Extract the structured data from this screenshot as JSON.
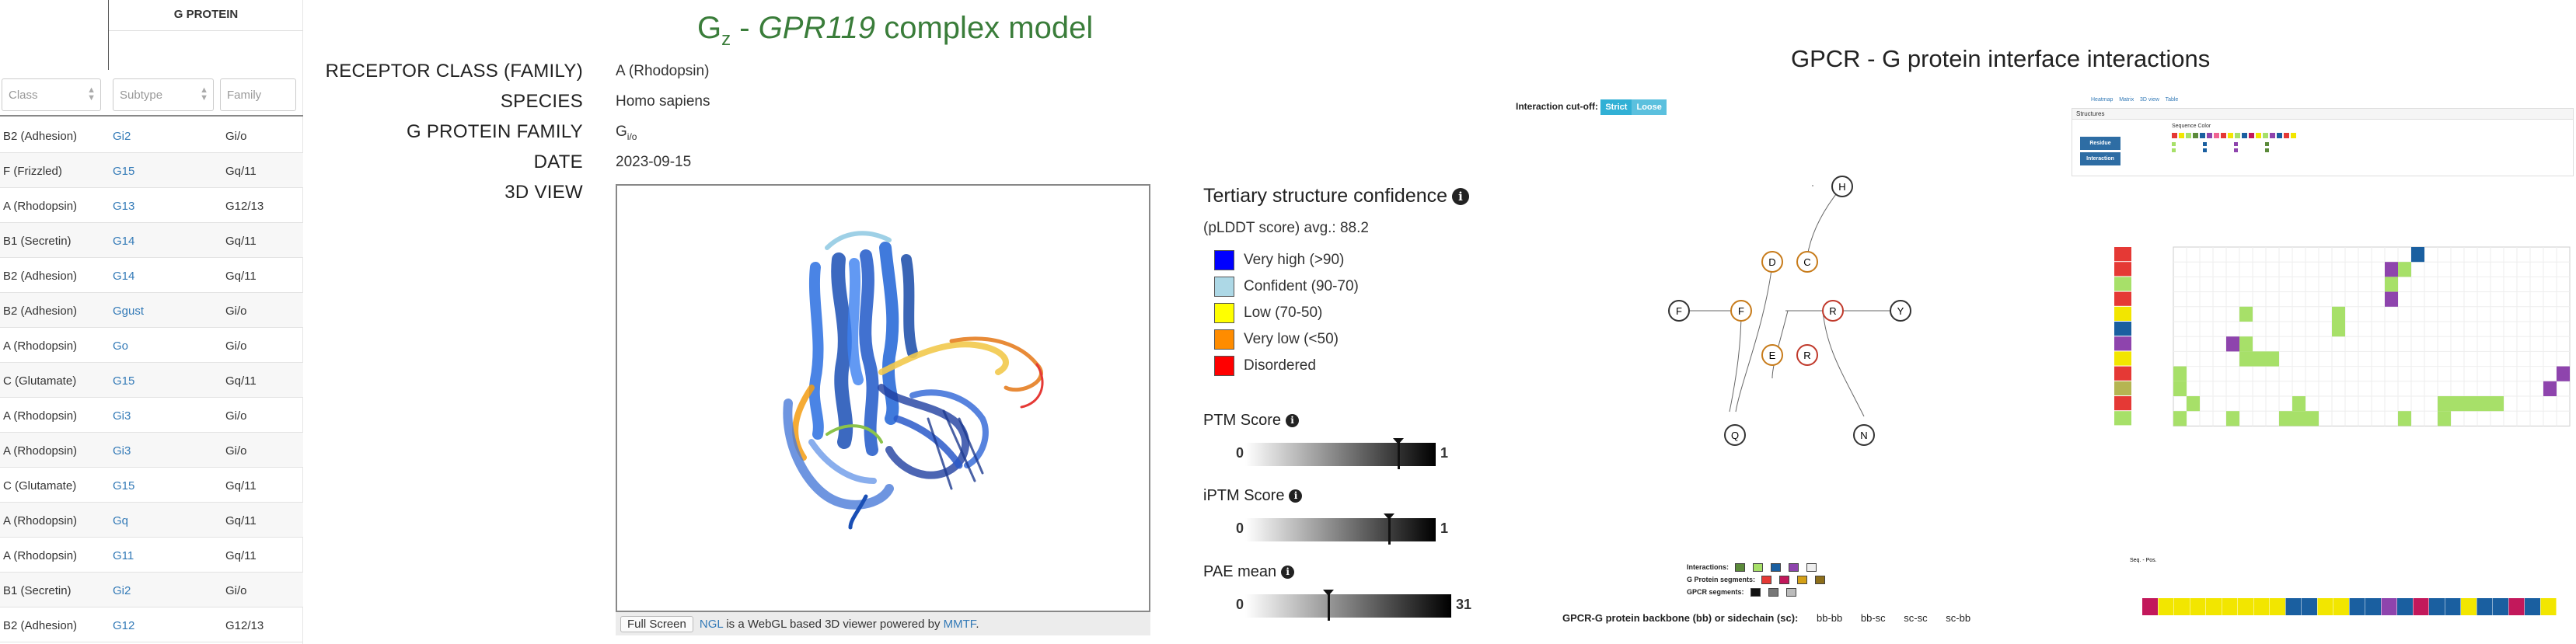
{
  "left_table": {
    "header": "G PROTEIN",
    "filters": [
      "Class",
      "Subtype",
      "Family"
    ],
    "rows": [
      {
        "cls": "B2 (Adhesion)",
        "subtype": "Gi2",
        "family": "Gi/o"
      },
      {
        "cls": "F (Frizzled)",
        "subtype": "G15",
        "family": "Gq/11"
      },
      {
        "cls": "A (Rhodopsin)",
        "subtype": "G13",
        "family": "G12/13"
      },
      {
        "cls": "B1 (Secretin)",
        "subtype": "G14",
        "family": "Gq/11"
      },
      {
        "cls": "B2 (Adhesion)",
        "subtype": "G14",
        "family": "Gq/11"
      },
      {
        "cls": "B2 (Adhesion)",
        "subtype": "Ggust",
        "family": "Gi/o"
      },
      {
        "cls": "A (Rhodopsin)",
        "subtype": "Go",
        "family": "Gi/o"
      },
      {
        "cls": "C (Glutamate)",
        "subtype": "G15",
        "family": "Gq/11"
      },
      {
        "cls": "A (Rhodopsin)",
        "subtype": "Gi3",
        "family": "Gi/o"
      },
      {
        "cls": "A (Rhodopsin)",
        "subtype": "Gi3",
        "family": "Gi/o"
      },
      {
        "cls": "C (Glutamate)",
        "subtype": "G15",
        "family": "Gq/11"
      },
      {
        "cls": "A (Rhodopsin)",
        "subtype": "Gq",
        "family": "Gq/11"
      },
      {
        "cls": "A (Rhodopsin)",
        "subtype": "G11",
        "family": "Gq/11"
      },
      {
        "cls": "B1 (Secretin)",
        "subtype": "Gi2",
        "family": "Gi/o"
      },
      {
        "cls": "B2 (Adhesion)",
        "subtype": "G12",
        "family": "G12/13"
      }
    ]
  },
  "title": {
    "g": "G",
    "sub": "z",
    "mid": " - ",
    "gene": "GPR119",
    "rest": " complex model"
  },
  "info": {
    "receptor_class_label": "RECEPTOR CLASS (FAMILY)",
    "receptor_class_value": "A (Rhodopsin)",
    "species_label": "SPECIES",
    "species_value": "Homo sapiens",
    "gprotein_family_label": "G PROTEIN FAMILY",
    "gprotein_family_value": "G",
    "gprotein_family_sub": "i/o",
    "date_label": "DATE",
    "date_value": "2023-09-15",
    "view_label": "3D VIEW"
  },
  "viewer": {
    "fullscreen": "Full Screen",
    "ngl": "NGL",
    "desc": " is a WebGL based 3D viewer powered by ",
    "mmtf": "MMTF",
    "end": "."
  },
  "confidence": {
    "title": "Tertiary structure confidence",
    "subtitle": "(pLDDT score) avg.: 88.2",
    "legend": [
      {
        "label": "Very high (>90)",
        "color": "#0000ff"
      },
      {
        "label": "Confident (90-70)",
        "color": "#add8e6"
      },
      {
        "label": "Low (70-50)",
        "color": "#ffff00"
      },
      {
        "label": "Very low (<50)",
        "color": "#ff8c00"
      },
      {
        "label": "Disordered",
        "color": "#ff0000"
      }
    ]
  },
  "scores": [
    {
      "title": "PTM Score",
      "min": "0",
      "max": "1",
      "fraction": 0.8
    },
    {
      "title": "iPTM Score",
      "min": "0",
      "max": "1",
      "fraction": 0.75
    },
    {
      "title": "PAE mean",
      "min": "0",
      "max": "31",
      "fraction": 0.4
    }
  ],
  "interface": {
    "title": "GPCR - G protein interface interactions",
    "cutoff_label": "Interaction cut-off:",
    "strict": "Strict",
    "loose": "Loose",
    "flare_nodes": [
      "H",
      "C",
      "D",
      "F",
      "F",
      "R",
      "Y",
      "E",
      "R",
      "Q",
      "N"
    ],
    "legend_interactions": "Interactions:",
    "legend_gsegments": "G Protein segments:",
    "legend_gpcrsegments": "GPCR segments:",
    "bbsc_label": "GPCR-G protein backbone (bb) or sidechain (sc):",
    "bbsc_opts": [
      "bb-bb",
      "bb-sc",
      "sc-sc",
      "sc-bb"
    ]
  },
  "heatmap": {
    "tabs": [
      "Heatmap",
      "Matrix",
      "3D view",
      "Table"
    ],
    "box_head": "Structures",
    "seq_color": "Sequence Color",
    "residue_btn": "Residue",
    "interaction_btn": "Interaction",
    "xlabel": "Seq. - Pos.",
    "interaction_colors": [
      "#a7e069",
      "#8e44ad",
      "#1a5fa0"
    ]
  }
}
